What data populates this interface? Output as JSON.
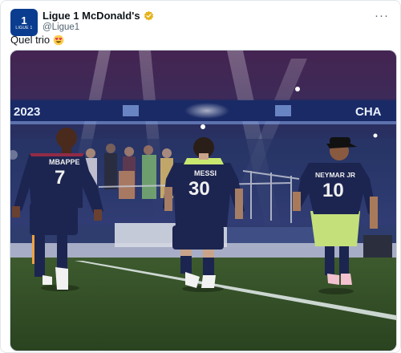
{
  "account": {
    "name": "Ligue 1 McDonald's",
    "handle": "@Ligue1",
    "avatar_line1": "1",
    "avatar_line2": "LIGUE 1"
  },
  "post": {
    "text": "Quel trio",
    "emoji": "heart-eyes-emoji"
  },
  "menu_icon": "···",
  "image": {
    "banner_left": "2023",
    "banner_right": "CHA",
    "players": [
      {
        "name": "MBAPPE",
        "number": "7"
      },
      {
        "name": "MESSI",
        "number": "30"
      },
      {
        "name": "NEYMAR JR",
        "number": "10"
      }
    ]
  },
  "colors": {
    "kit": "#1c2550",
    "verified_gold": "#e5b31a",
    "avatar_bg": "#0a3d8f"
  }
}
